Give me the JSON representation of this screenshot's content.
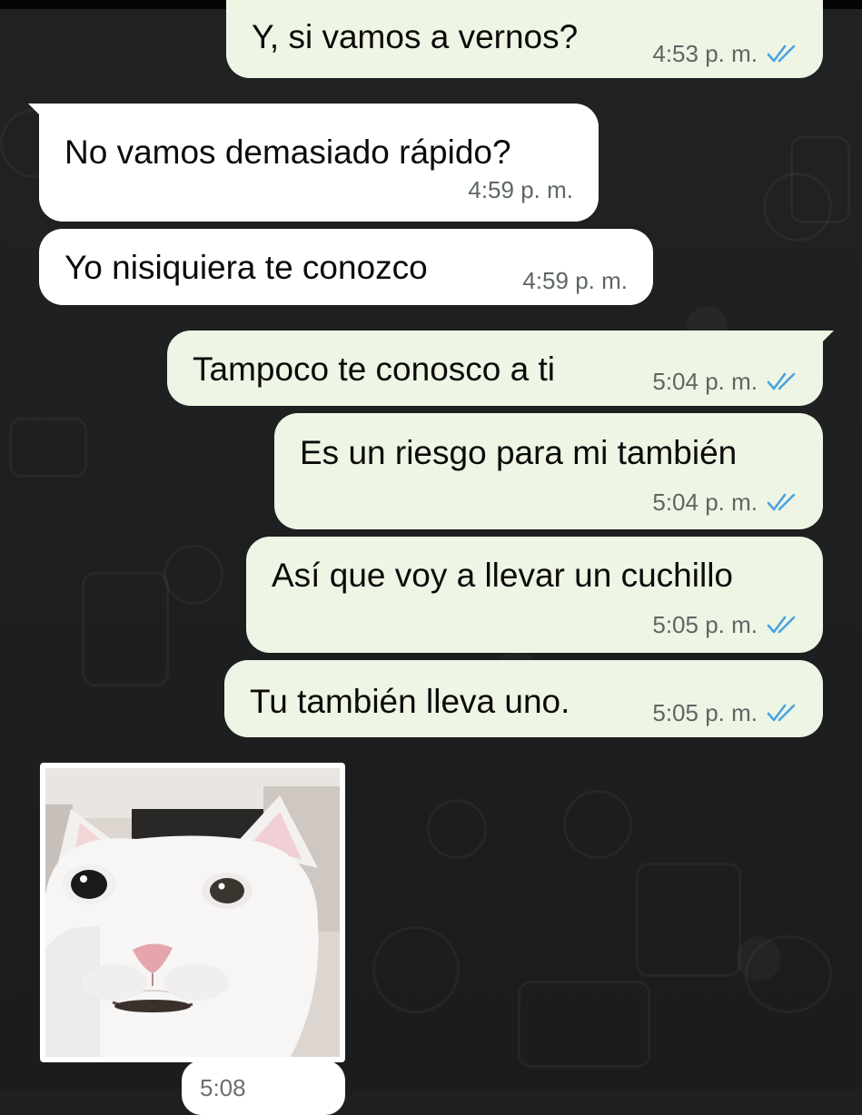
{
  "chat": {
    "messages": [
      {
        "direction": "out",
        "text": "Y, si vamos a vernos?",
        "time": "4:53 p. m.",
        "status": "read"
      },
      {
        "direction": "in",
        "text": "No vamos demasiado rápido?",
        "time": "4:59 p. m."
      },
      {
        "direction": "in",
        "text": "Yo nisiquiera te conozco",
        "time": "4:59 p. m."
      },
      {
        "direction": "out",
        "text": "Tampoco te conosco a ti",
        "time": "5:04 p. m.",
        "status": "read"
      },
      {
        "direction": "out",
        "text": "Es un riesgo para mi también",
        "time": "5:04 p. m.",
        "status": "read"
      },
      {
        "direction": "out",
        "text": "Así que voy a llevar un cuchillo",
        "time": "5:05 p. m.",
        "status": "read"
      },
      {
        "direction": "out",
        "text": "Tu también lleva uno.",
        "time": "5:05 p. m.",
        "status": "read"
      }
    ],
    "image_message": {
      "direction": "in",
      "subject": "white-cat-photo"
    },
    "partial_next_time": "5:08"
  },
  "theme": {
    "outgoing_bubble": "#eef5e4",
    "incoming_bubble": "#ffffff",
    "read_tick_color": "#4aa3e0",
    "background": "#1d1f20"
  },
  "icons": {
    "read_receipt": "double-check-icon"
  }
}
